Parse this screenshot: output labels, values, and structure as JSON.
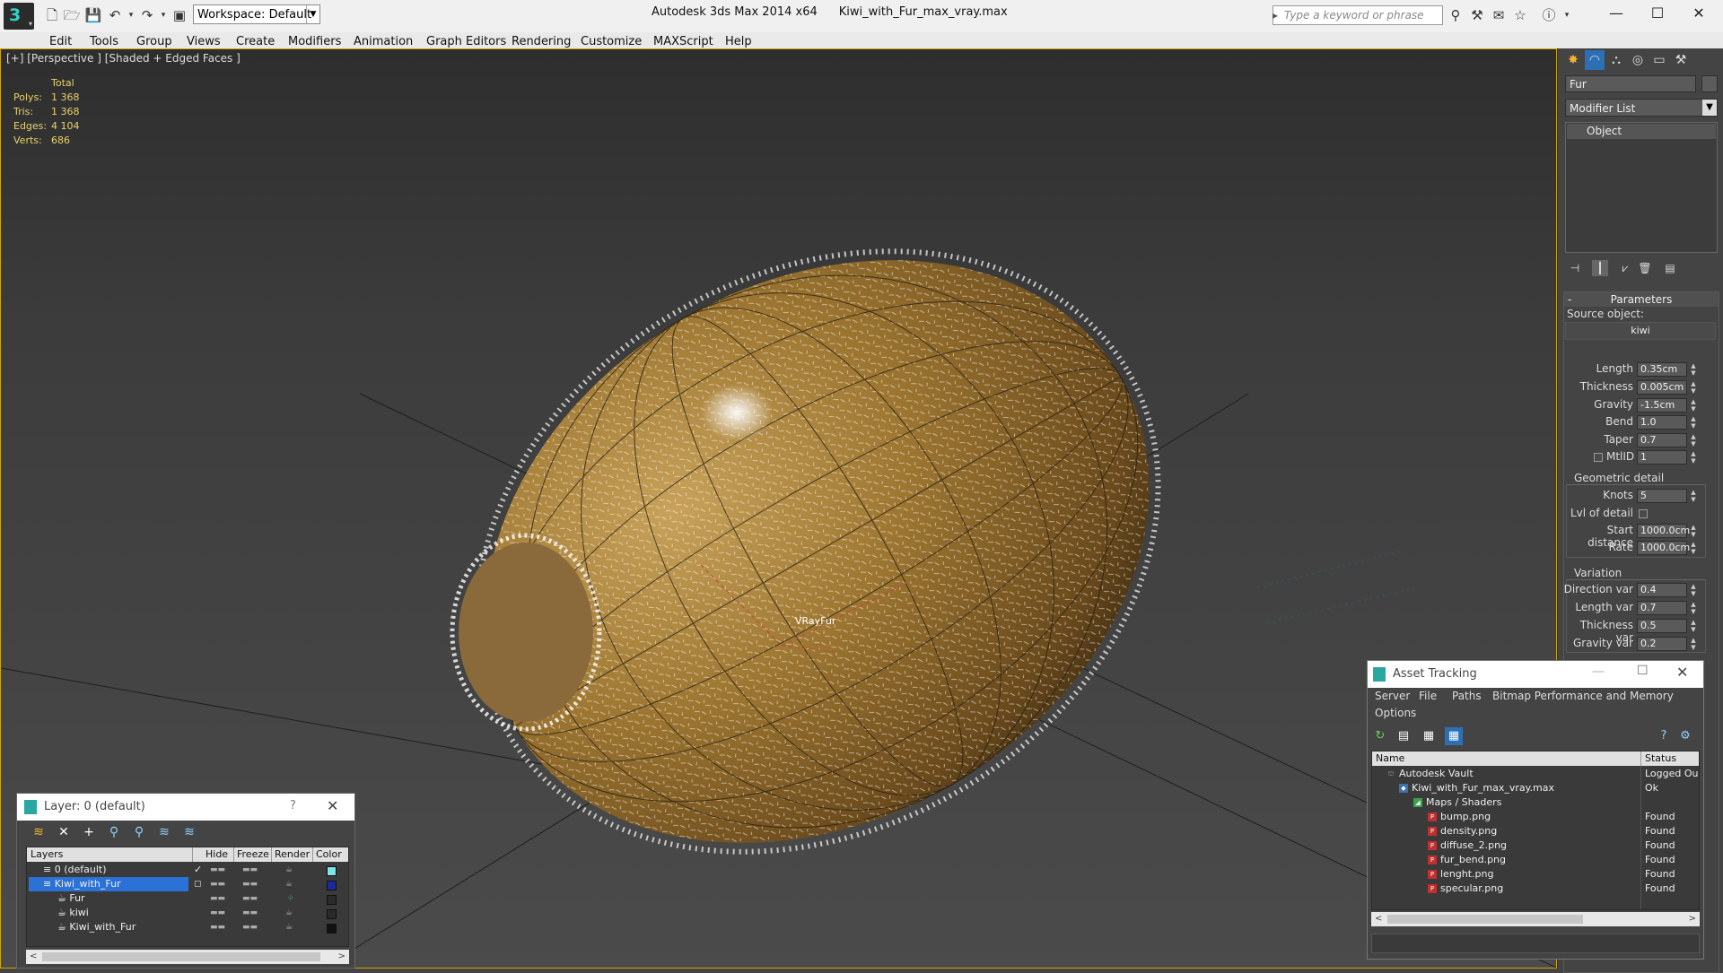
{
  "titlebar": {
    "workspace": "Workspace: Default",
    "app_name": "Autodesk 3ds Max  2014 x64",
    "file_name": "Kiwi_with_Fur_max_vray.max",
    "search_placeholder": "Type a keyword or phrase"
  },
  "menu": [
    "Edit",
    "Tools",
    "Group",
    "Views",
    "Create",
    "Modifiers",
    "Animation",
    "Graph Editors",
    "Rendering",
    "Customize",
    "MAXScript",
    "Help"
  ],
  "viewport": {
    "label": "[+] [Perspective ] [Shaded + Edged Faces ]",
    "stats": {
      "header": "Total",
      "rows": [
        {
          "k": "Polys:",
          "v": "1 368"
        },
        {
          "k": "Tris:",
          "v": "1 368"
        },
        {
          "k": "Edges:",
          "v": "4 104"
        },
        {
          "k": "Verts:",
          "v": "686"
        }
      ]
    },
    "object_label": "VRayFur"
  },
  "command_panel": {
    "object_name": "Fur",
    "modifier_list": "Modifier List",
    "stack_item": "Object",
    "parameters": {
      "title": "Parameters",
      "source_label": "Source object:",
      "source_value": "kiwi",
      "fields": [
        {
          "label": "Length",
          "value": "0.35cm"
        },
        {
          "label": "Thickness",
          "value": "0.005cm"
        },
        {
          "label": "Gravity",
          "value": "-1.5cm"
        },
        {
          "label": "Bend",
          "value": "1.0"
        },
        {
          "label": "Taper",
          "value": "0.7"
        },
        {
          "label": "MtlID",
          "value": "1"
        }
      ]
    },
    "geometric": {
      "title": "Geometric detail",
      "knots_label": "Knots",
      "knots_value": "5",
      "lod_label": "Lvl of detail",
      "start_label": "Start distance",
      "start_value": "1000.0cm",
      "rate_label": "Rate",
      "rate_value": "1000.0cm"
    },
    "variation": {
      "title": "Variation",
      "fields": [
        {
          "label": "Direction var",
          "value": "0.4"
        },
        {
          "label": "Length var",
          "value": "0.7"
        },
        {
          "label": "Thickness var",
          "value": "0.5"
        },
        {
          "label": "Gravity var",
          "value": "0.2"
        }
      ]
    }
  },
  "layer_panel": {
    "title": "Layer: 0 (default)",
    "help": "?",
    "columns": [
      "Layers",
      "Hide",
      "Freeze",
      "Render",
      "Color"
    ],
    "rows": [
      {
        "name": "0 (default)",
        "color": "#7fe3e8"
      },
      {
        "name": "Kiwi_with_Fur",
        "color": "#1a2a9c"
      },
      {
        "name": "Fur",
        "color": "#2a2a2a"
      },
      {
        "name": "kiwi",
        "color": "#2a2a2a"
      },
      {
        "name": "Kiwi_with_Fur",
        "color": "#111111"
      }
    ]
  },
  "asset_panel": {
    "title": "Asset Tracking",
    "menu": [
      "Server",
      "File",
      "Paths",
      "Bitmap Performance and Memory",
      "Options"
    ],
    "columns": [
      "Name",
      "Status"
    ],
    "rows": [
      {
        "name": "Autodesk Vault",
        "status": "Logged Ou"
      },
      {
        "name": "Kiwi_with_Fur_max_vray.max",
        "status": "Ok"
      },
      {
        "name": "Maps / Shaders",
        "status": ""
      },
      {
        "name": "bump.png",
        "status": "Found"
      },
      {
        "name": "density.png",
        "status": "Found"
      },
      {
        "name": "diffuse_2.png",
        "status": "Found"
      },
      {
        "name": "fur_bend.png",
        "status": "Found"
      },
      {
        "name": "lenght.png",
        "status": "Found"
      },
      {
        "name": "specular.png",
        "status": "Found"
      }
    ]
  }
}
